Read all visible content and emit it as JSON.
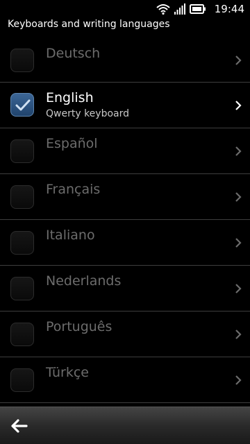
{
  "status_bar": {
    "time": "19:44",
    "icons": [
      "wifi-icon",
      "signal-icon",
      "battery-icon"
    ]
  },
  "header": {
    "title": "Keyboards and writing languages"
  },
  "languages": [
    {
      "name": "Deutsch",
      "subtitle": "",
      "checked": false
    },
    {
      "name": "English",
      "subtitle": "Qwerty keyboard",
      "checked": true
    },
    {
      "name": "Español",
      "subtitle": "",
      "checked": false
    },
    {
      "name": "Français",
      "subtitle": "",
      "checked": false
    },
    {
      "name": "Italiano",
      "subtitle": "",
      "checked": false
    },
    {
      "name": "Nederlands",
      "subtitle": "",
      "checked": false
    },
    {
      "name": "Português",
      "subtitle": "",
      "checked": false
    },
    {
      "name": "Türkçe",
      "subtitle": "",
      "checked": false
    }
  ],
  "toolbar": {
    "back_icon": "back-arrow-icon"
  },
  "colors": {
    "background": "#000000",
    "accent": "#3c6696",
    "inactive_text": "#6c6c6c",
    "divider": "#3e3e3e"
  }
}
